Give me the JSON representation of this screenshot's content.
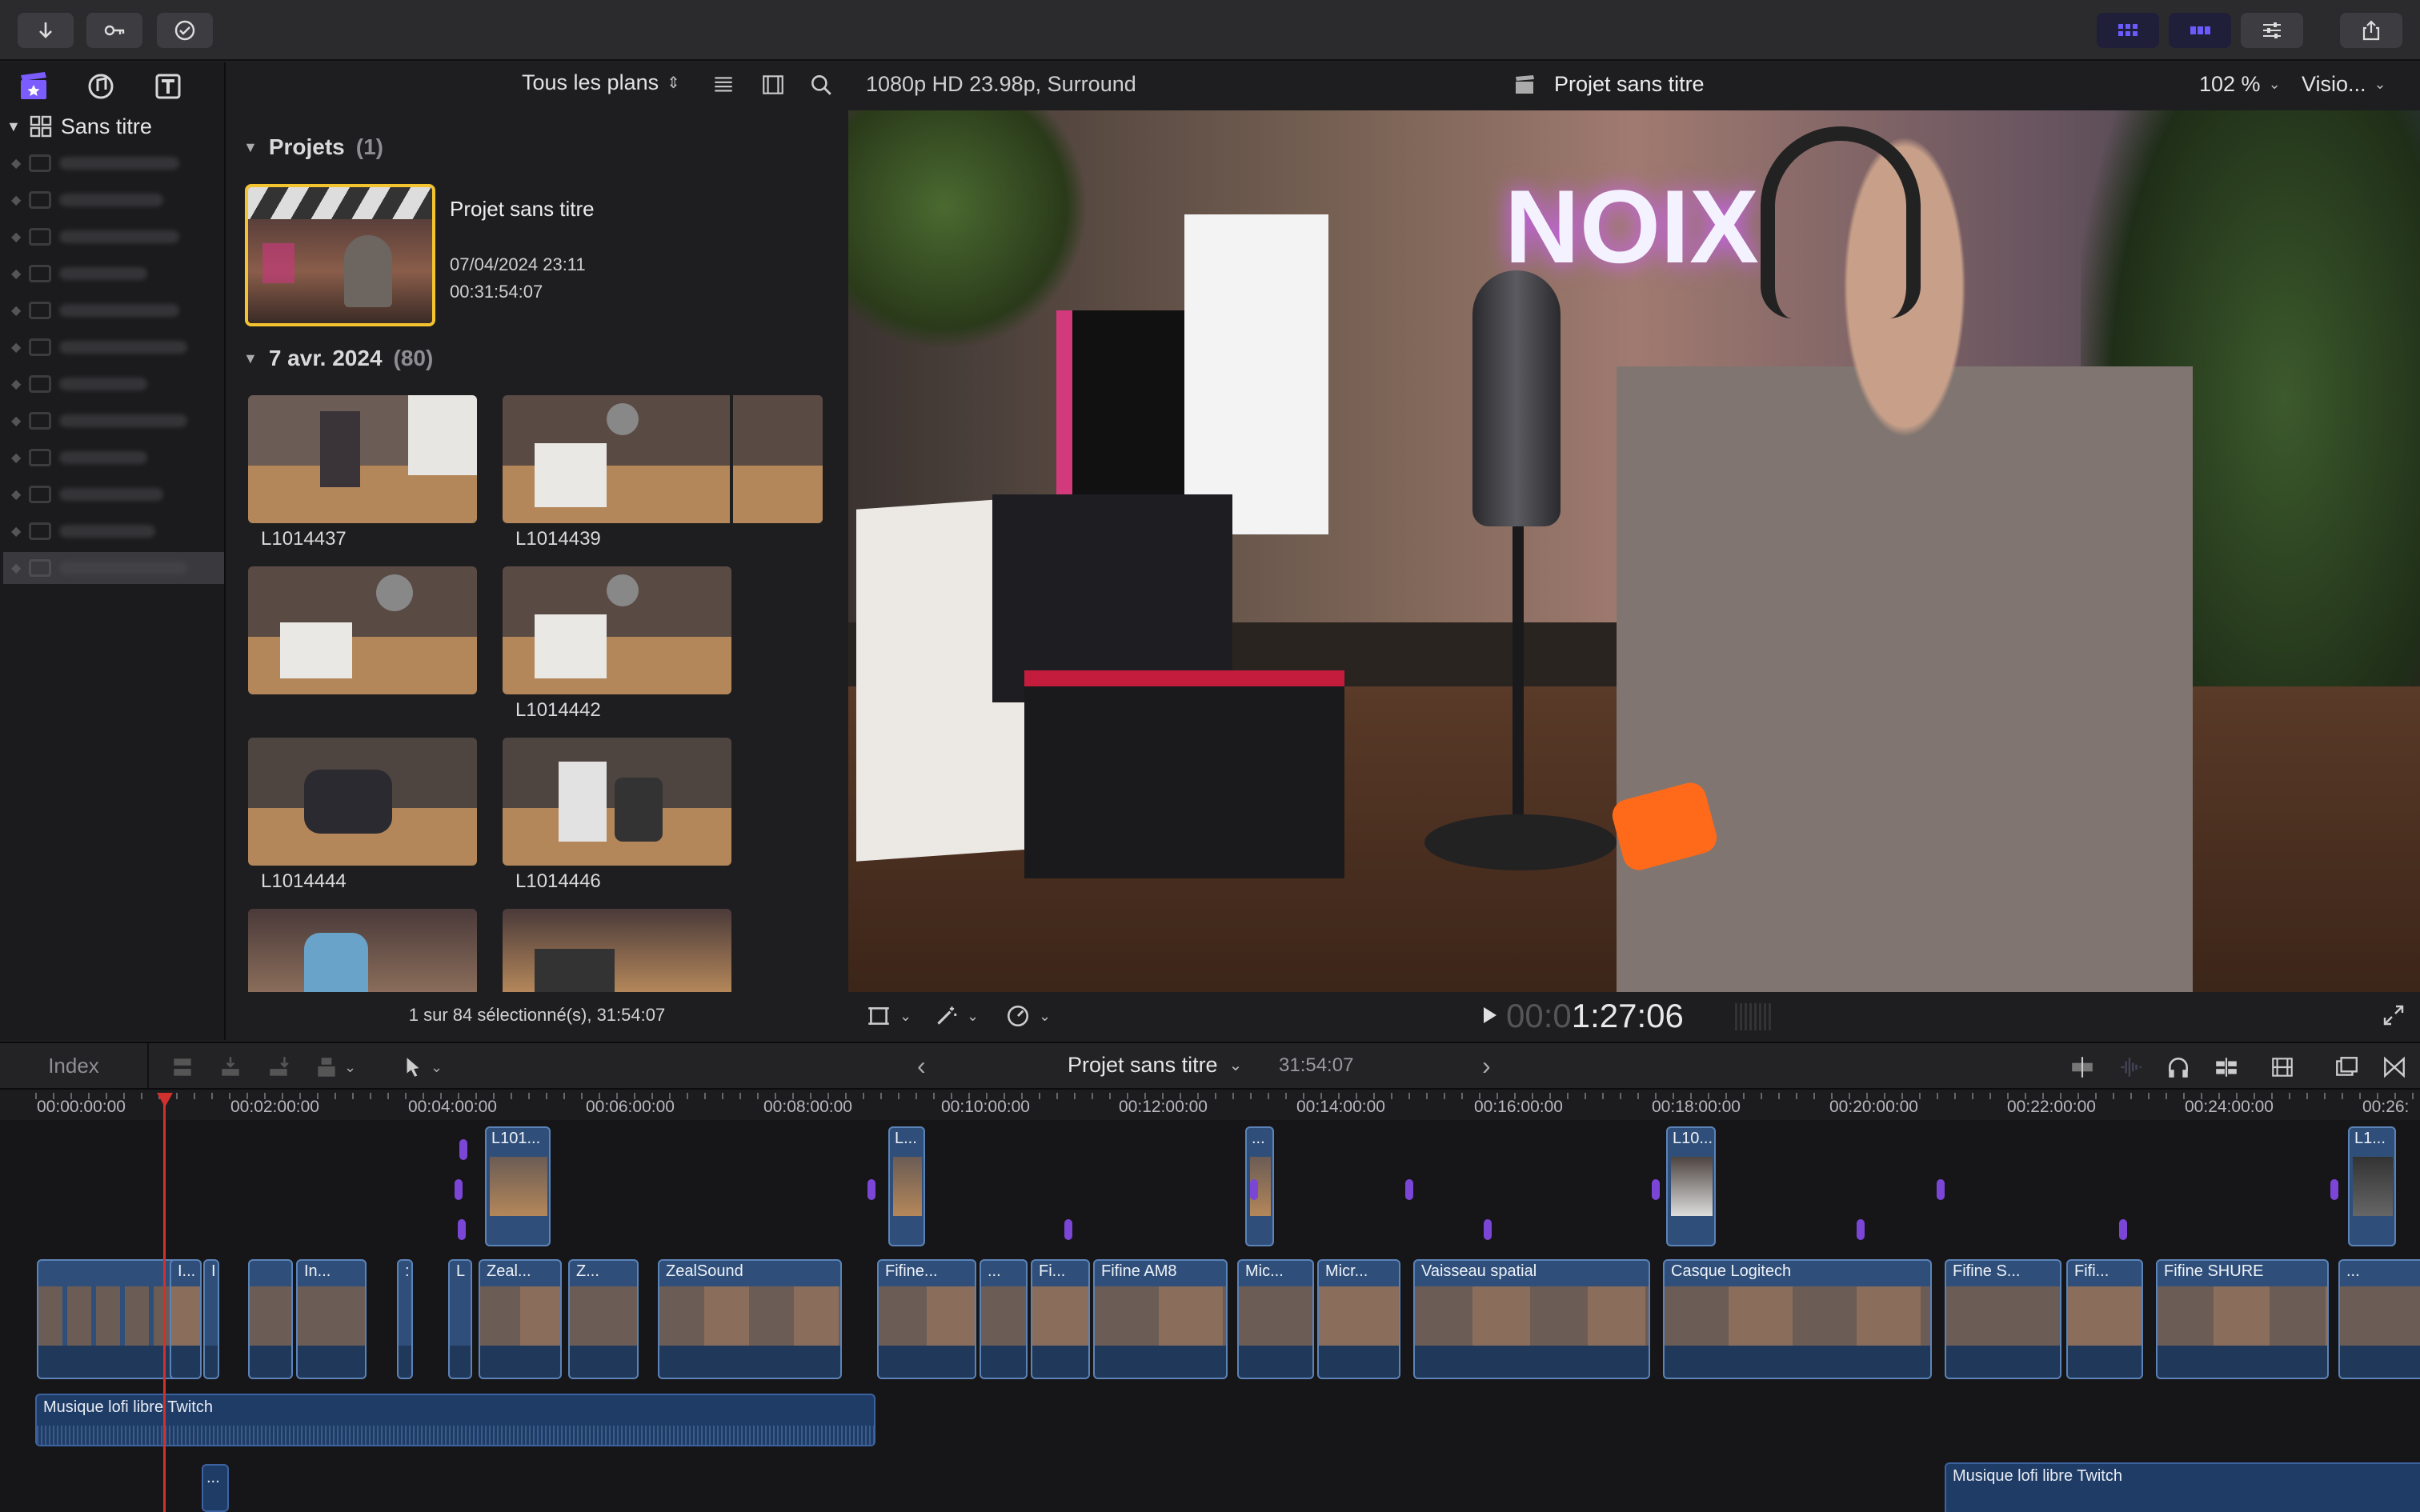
{
  "sidebar": {
    "library_name": "Sans titre"
  },
  "browser": {
    "filter_label": "Tous les plans",
    "projects_section": {
      "title": "Projets",
      "count": "(1)"
    },
    "project": {
      "name": "Projet sans titre",
      "date": "07/04/2024 23:11",
      "duration": "00:31:54:07"
    },
    "date_section": {
      "title": "7 avr. 2024",
      "count": "(80)"
    },
    "clips": [
      "L1014437",
      "L1014439",
      "L1014442",
      "L1014444",
      "L1014446"
    ],
    "footer_status": "1 sur 84 sélectionné(s), 31:54:07"
  },
  "viewer": {
    "format": "1080p HD 23.98p, Surround",
    "project_title": "Projet sans titre",
    "zoom": "102 %",
    "view_menu": "Visio...",
    "timecode_dim": "00:0",
    "timecode_bright": "1:27:06",
    "neon_sign": "NOIX"
  },
  "timeline": {
    "index_label": "Index",
    "project_title": "Projet sans titre",
    "duration": "31:54:07",
    "ruler": [
      "00:00:00:00",
      "00:02:00:00",
      "00:04:00:00",
      "00:06:00:00",
      "00:08:00:00",
      "00:10:00:00",
      "00:12:00:00",
      "00:14:00:00",
      "00:16:00:00",
      "00:18:00:00",
      "00:20:00:00",
      "00:22:00:00",
      "00:24:00:00",
      "00:26:"
    ],
    "connected_clips": [
      "L101...",
      "L...",
      "...",
      "L10...",
      "L1..."
    ],
    "primary_clips": [
      "I...",
      "I",
      "In...",
      ":",
      "L",
      "Zeal...",
      "Z...",
      "ZealSound",
      "Fifine...",
      "...",
      "Fi...",
      "Fifine AM8",
      "Mic...",
      "Micr...",
      "Vaisseau spatial",
      "Casque Logitech",
      "Fifine S...",
      "Fifi...",
      "Fifine SHURE",
      "..."
    ],
    "music_1": "Musique lofi libre Twitch",
    "music_2": "Musique lofi libre Twitch",
    "small_clip": "..."
  },
  "colors": {
    "accent": "#f4c430",
    "clip_blue": "#2f4f7a",
    "marker_purple": "#7b46d6",
    "playhead": "#d0312d"
  }
}
